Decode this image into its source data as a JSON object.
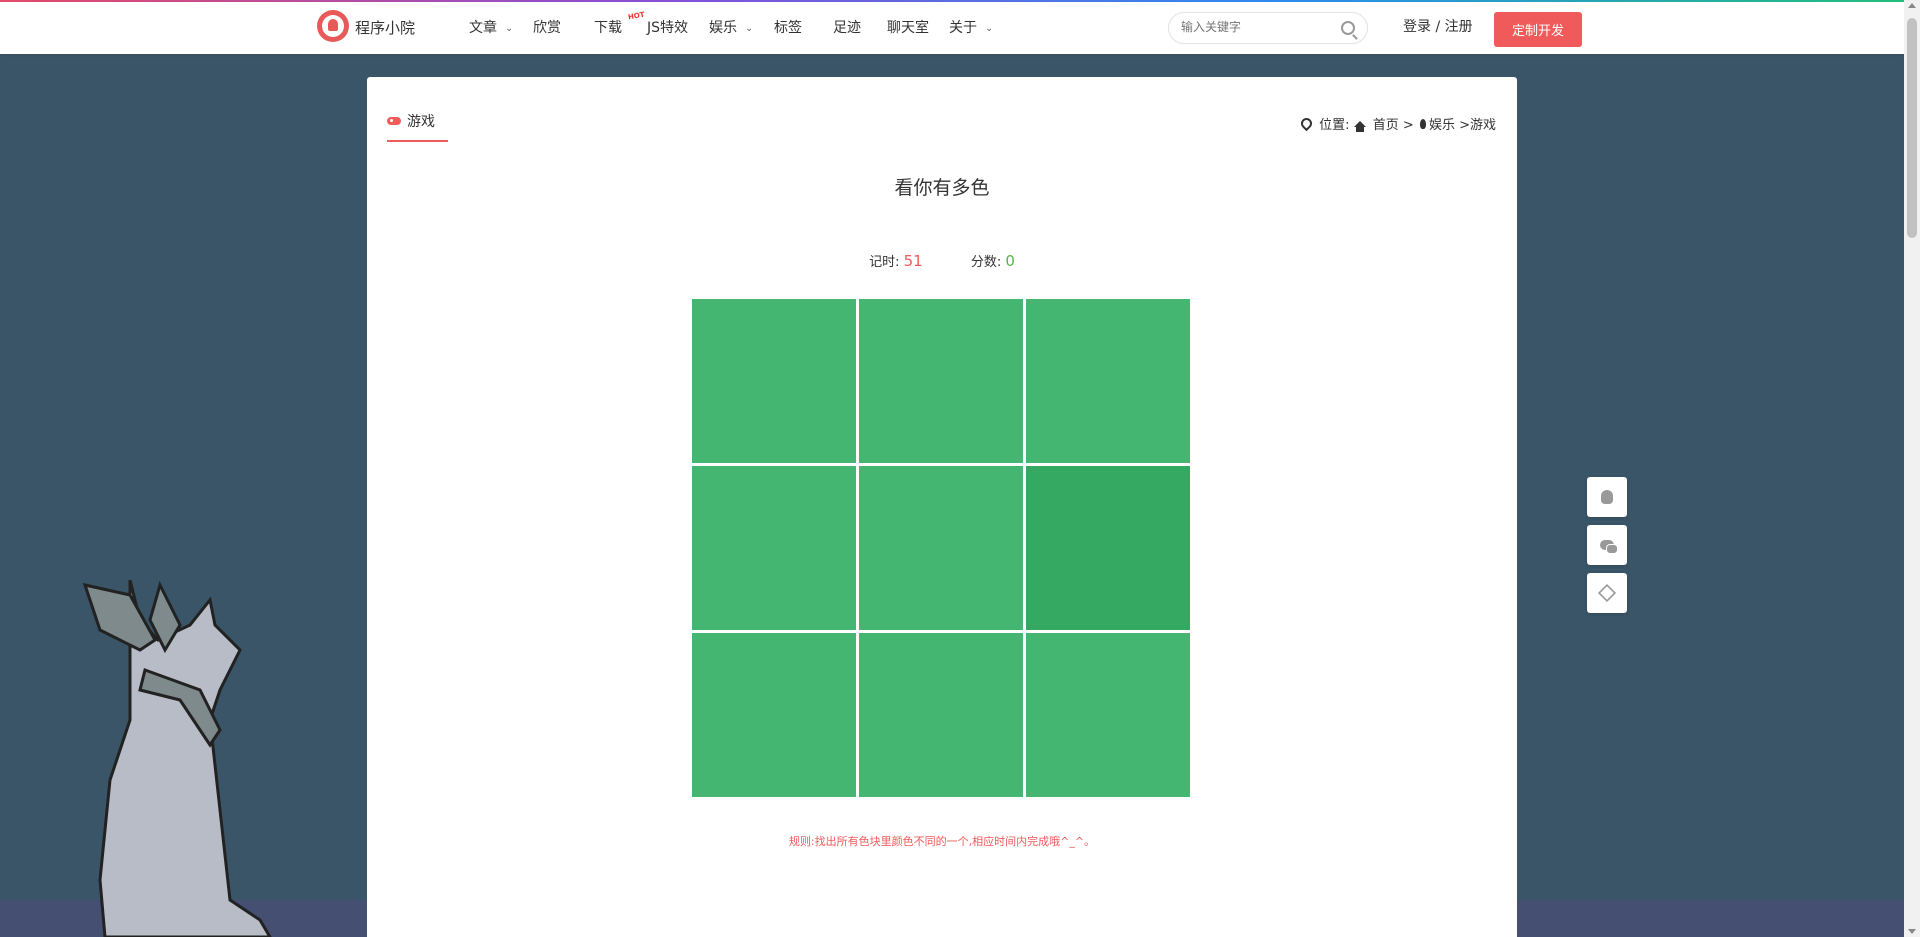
{
  "header": {
    "brand": "程序小院",
    "nav": [
      {
        "label": "文章",
        "caret": true
      },
      {
        "label": "欣赏",
        "caret": false
      },
      {
        "label": "下载",
        "caret": false
      },
      {
        "label": "JS特效",
        "caret": false,
        "badge": "HOT"
      },
      {
        "label": "娱乐",
        "caret": true
      },
      {
        "label": "标签",
        "caret": false
      },
      {
        "label": "足迹",
        "caret": false
      },
      {
        "label": "聊天室",
        "caret": false
      },
      {
        "label": "关于",
        "caret": true
      }
    ],
    "search_placeholder": "输入关键字",
    "login_label": "登录 / 注册",
    "custom_button": "定制开发"
  },
  "content": {
    "tab_label": "游戏",
    "breadcrumb": {
      "prefix": "位置:",
      "home": "首页",
      "sep": ">",
      "category": "娱乐",
      "current": ">游戏"
    },
    "game_title": "看你有多色",
    "timer_label": "记时:",
    "timer_value": "51",
    "score_label": "分数:",
    "score_value": "0",
    "grid": {
      "rows": 3,
      "cols": 3,
      "odd_index": 5,
      "base_color": "#44b672",
      "odd_color": "#35a862"
    },
    "rule": "规则:找出所有色块里颜色不同的一个,相应时间内完成哦^_^。"
  },
  "colors": {
    "accent": "#f05a5a",
    "success": "#5ab448",
    "page_bg": "#3a5567"
  },
  "side_buttons": [
    "qq-icon",
    "wechat-icon",
    "diamond-icon"
  ]
}
